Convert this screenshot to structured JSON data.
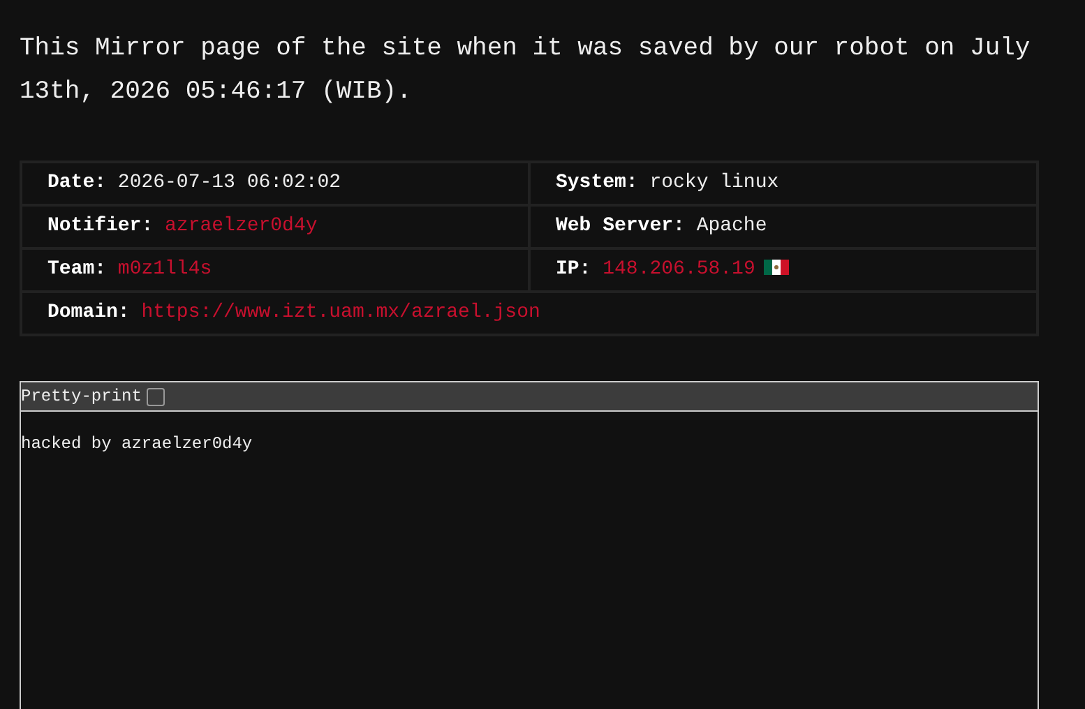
{
  "intro": "This Mirror page of the site when it was saved by our robot on July 13th, 2026 05:46:17 (WIB).",
  "info_rows": [
    [
      {
        "label": "Date:",
        "value": "2026-07-13 06:02:02",
        "kind": "text"
      },
      {
        "label": "System:",
        "value": "rocky linux",
        "kind": "text"
      }
    ],
    [
      {
        "label": "Notifier:",
        "value": "azraelzer0d4y",
        "kind": "link"
      },
      {
        "label": "Web Server:",
        "value": "Apache",
        "kind": "text"
      }
    ],
    [
      {
        "label": "Team:",
        "value": "m0z1ll4s",
        "kind": "link"
      },
      {
        "label": "IP:",
        "value": "148.206.58.19",
        "kind": "link",
        "flag": true
      }
    ],
    [
      {
        "label": "Domain:",
        "value": "https://www.izt.uam.mx/azrael.json",
        "kind": "link"
      }
    ]
  ],
  "viewer": {
    "toggle_label": "Pretty-print",
    "pretty_print": false,
    "content": "hacked by azraelzer0d4y"
  }
}
